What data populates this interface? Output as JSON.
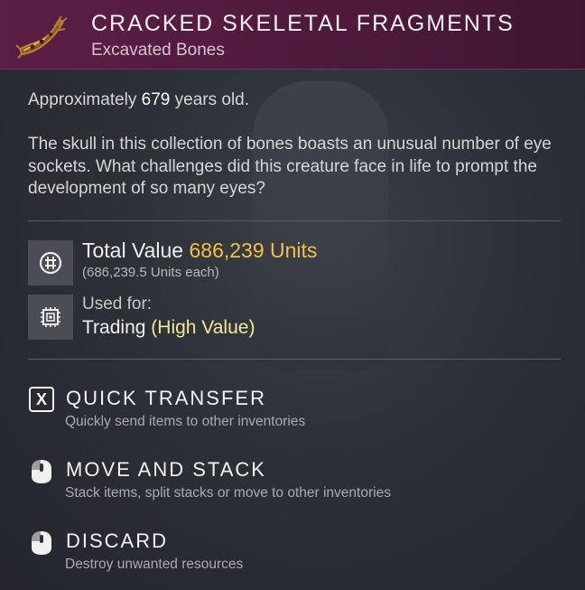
{
  "header": {
    "title": "CRACKED SKELETAL FRAGMENTS",
    "subtitle": "Excavated Bones",
    "icon": "bone-fragment-icon"
  },
  "details": {
    "age_prefix": "Approximately",
    "age_number": "679",
    "age_suffix": "years old.",
    "description": "The skull in this collection of bones boasts an unusual number of eye sockets. What challenges did this creature face in life to prompt the development of so many eyes?"
  },
  "value": {
    "label": "Total Value",
    "amount": "686,239 Units",
    "each": "(686,239.5 Units each)",
    "icon": "units-currency-icon"
  },
  "usage": {
    "label": "Used for:",
    "value_prefix": "Trading",
    "value_highlight": "(High Value)",
    "icon": "trade-chip-icon"
  },
  "actions": [
    {
      "key": "X",
      "name": "QUICK TRANSFER",
      "hint": "Quickly send items to other inventories",
      "icon": "x-key-icon"
    },
    {
      "name": "MOVE AND STACK",
      "hint": "Stack items, split stacks or move to other inventories",
      "icon": "mouse-left-click-icon"
    },
    {
      "name": "DISCARD",
      "hint": "Destroy unwanted resources",
      "icon": "mouse-hold-icon"
    }
  ],
  "colors": {
    "header_bg": "#5b1e45",
    "gold_value": "#f3c044",
    "high_value": "#f3e79a"
  }
}
